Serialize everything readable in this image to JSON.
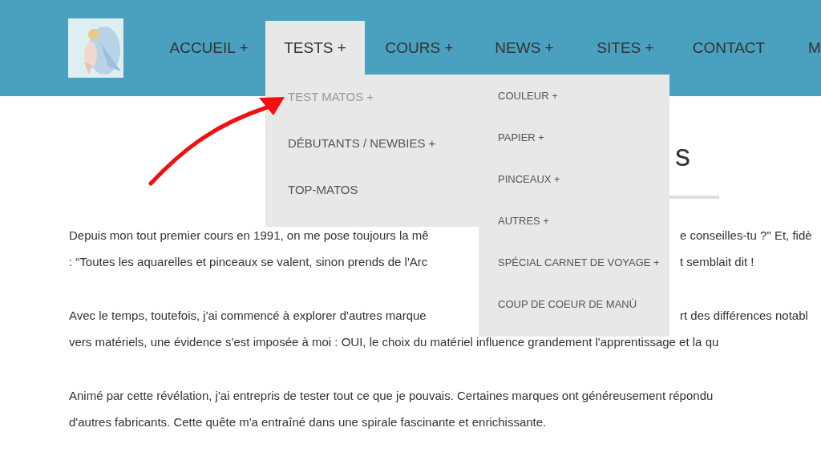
{
  "nav": {
    "items": [
      {
        "label": "ACCUEIL +",
        "selected": false
      },
      {
        "label": "TESTS +",
        "selected": true
      },
      {
        "label": "COURS +",
        "selected": false
      },
      {
        "label": "NEWS +",
        "selected": false
      },
      {
        "label": "SITES +",
        "selected": false
      },
      {
        "label": "CONTACT",
        "selected": false
      },
      {
        "label": "M",
        "selected": false
      }
    ]
  },
  "dropdown": {
    "items": [
      {
        "label": "TEST MATOS +",
        "selected": true
      },
      {
        "label": "DÉBUTANTS / NEWBIES +",
        "selected": false
      },
      {
        "label": "TOP-MATOS",
        "selected": false
      }
    ],
    "submenu": [
      "COULEUR +",
      "PAPIER +",
      "PINCEAUX +",
      "AUTRES +",
      "SPÉCIAL CARNET DE VOYAGE +",
      "COUP DE COEUR DE MANÙ"
    ]
  },
  "heading": "s",
  "paragraphs": [
    [
      [
        "Depuis mon tout premier cours en 1991, on me pose toujours la mê",
        "e conseilles-tu ?\" Et, fidè"
      ],
      [
        ": “Toutes les aquarelles et pinceaux se valent, sinon prends de l'Arc",
        "t semblait dit !"
      ]
    ],
    [
      [
        "Avec le temps, toutefois, j'ai commencé à explorer d'autres marque",
        "rt des différences notabl"
      ],
      [
        "vers matériels, une évidence s'est imposée à moi : OUI, le choix du matériel influence grandement l'apprentissage et la qu"
      ]
    ],
    [
      [
        "Animé par cette révélation, j'ai entrepris de tester tout ce que je pouvais. Certaines marques ont généreusement répondu"
      ],
      [
        "d'autres fabricants. Cette quête m'a entraîné dans une spirale fascinante et enrichissante."
      ]
    ]
  ]
}
